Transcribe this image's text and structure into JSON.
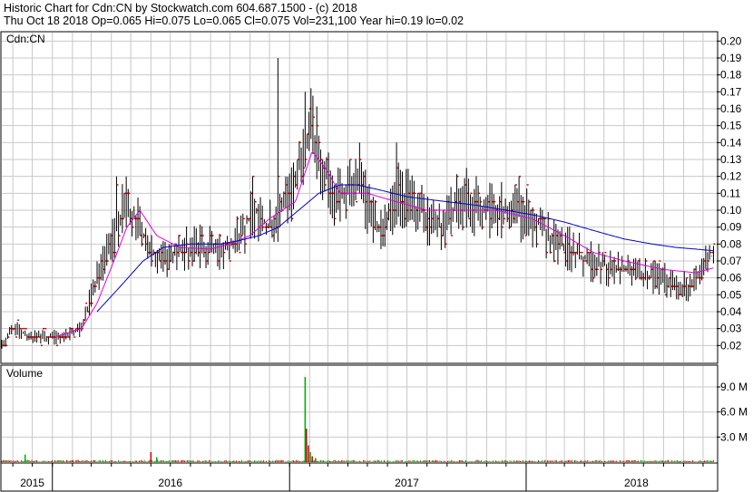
{
  "header": {
    "line1": "Historic Chart for Cdn:CN by Stockwatch.com 604.687.1500 - (c) 2018",
    "line2": "Thu Oct 18 2018   Op=0.065   Hi=0.075   Lo=0.065   Cl=0.075   Vol=231,100   Year hi=0.19   lo=0.02"
  },
  "colors": {
    "price_bars": "#000000",
    "close_marker": "#cc0000",
    "ma_short": "#e000e0",
    "ma_long": "#0000cc",
    "volume_up": "#00aa00",
    "volume_down": "#cc0000",
    "grid": "#c8c8c8"
  },
  "chart_data": [
    {
      "type": "line",
      "title": "",
      "symbol_label": "Cdn:CN",
      "y_ticks": [
        "0.20",
        "0.19",
        "0.18",
        "0.17",
        "0.16",
        "0.15",
        "0.14",
        "0.13",
        "0.12",
        "0.11",
        "0.10",
        "0.09",
        "0.08",
        "0.07",
        "0.06",
        "0.05",
        "0.04",
        "0.03",
        "0.02"
      ],
      "ylim": [
        0.01,
        0.205
      ],
      "xlim": [
        "2015-10-15",
        "2018-10-22"
      ],
      "x_labels": [
        {
          "label": "2015",
          "pos": "2015-12-01"
        },
        {
          "label": "2016",
          "pos": "2016-07-01"
        },
        {
          "label": "2017",
          "pos": "2017-07-01"
        },
        {
          "label": "2018",
          "pos": "2018-06-20"
        }
      ],
      "year_boundaries": [
        "2016-01-01",
        "2017-01-01",
        "2018-01-01"
      ],
      "vgrid_months": [
        "2015-11-01",
        "2015-12-01",
        "2016-01-01",
        "2016-02-01",
        "2016-03-01",
        "2016-04-01",
        "2016-05-01",
        "2016-06-01",
        "2016-07-01",
        "2016-08-01",
        "2016-09-01",
        "2016-10-01",
        "2016-11-01",
        "2016-12-01",
        "2017-01-01",
        "2017-02-01",
        "2017-03-01",
        "2017-04-01",
        "2017-05-01",
        "2017-06-01",
        "2017-07-01",
        "2017-08-01",
        "2017-09-01",
        "2017-10-01",
        "2017-11-01",
        "2017-12-01",
        "2018-01-01",
        "2018-02-01",
        "2018-03-01",
        "2018-04-01",
        "2018-05-01",
        "2018-06-01",
        "2018-07-01",
        "2018-08-01",
        "2018-09-01",
        "2018-10-01"
      ],
      "price_keyframes": [
        {
          "date": "2015-10-15",
          "close": 0.02
        },
        {
          "date": "2015-11-01",
          "close": 0.03
        },
        {
          "date": "2015-12-01",
          "close": 0.025
        },
        {
          "date": "2016-01-10",
          "close": 0.025
        },
        {
          "date": "2016-02-15",
          "close": 0.03
        },
        {
          "date": "2016-03-10",
          "close": 0.06
        },
        {
          "date": "2016-04-01",
          "close": 0.08
        },
        {
          "date": "2016-04-20",
          "close": 0.1
        },
        {
          "date": "2016-05-10",
          "close": 0.095
        },
        {
          "date": "2016-06-10",
          "close": 0.07
        },
        {
          "date": "2016-07-15",
          "close": 0.075
        },
        {
          "date": "2016-08-15",
          "close": 0.08
        },
        {
          "date": "2016-09-15",
          "close": 0.075
        },
        {
          "date": "2016-10-15",
          "close": 0.085
        },
        {
          "date": "2016-11-10",
          "close": 0.1
        },
        {
          "date": "2016-12-01",
          "close": 0.09
        },
        {
          "date": "2017-01-05",
          "close": 0.11
        },
        {
          "date": "2017-02-01",
          "close": 0.15
        },
        {
          "date": "2017-02-20",
          "close": 0.13
        },
        {
          "date": "2017-03-10",
          "close": 0.105
        },
        {
          "date": "2017-04-15",
          "close": 0.115
        },
        {
          "date": "2017-05-20",
          "close": 0.09
        },
        {
          "date": "2017-06-20",
          "close": 0.11
        },
        {
          "date": "2017-07-20",
          "close": 0.1
        },
        {
          "date": "2017-08-20",
          "close": 0.09
        },
        {
          "date": "2017-09-20",
          "close": 0.105
        },
        {
          "date": "2017-11-01",
          "close": 0.1
        },
        {
          "date": "2017-12-01",
          "close": 0.1
        },
        {
          "date": "2018-01-10",
          "close": 0.095
        },
        {
          "date": "2018-02-20",
          "close": 0.08
        },
        {
          "date": "2018-04-10",
          "close": 0.07
        },
        {
          "date": "2018-05-20",
          "close": 0.065
        },
        {
          "date": "2018-07-20",
          "close": 0.06
        },
        {
          "date": "2018-09-10",
          "close": 0.055
        },
        {
          "date": "2018-10-18",
          "close": 0.075
        }
      ],
      "spikes": [
        {
          "date": "2016-04-10",
          "high": 0.12
        },
        {
          "date": "2016-04-25",
          "high": 0.12
        },
        {
          "date": "2016-11-05",
          "high": 0.12
        },
        {
          "date": "2016-12-15",
          "high": 0.19
        },
        {
          "date": "2017-01-25",
          "high": 0.17
        },
        {
          "date": "2017-02-05",
          "high": 0.16
        },
        {
          "date": "2017-04-20",
          "high": 0.14
        },
        {
          "date": "2017-06-15",
          "high": 0.14
        },
        {
          "date": "2017-10-01",
          "high": 0.125
        },
        {
          "date": "2017-12-20",
          "high": 0.12
        }
      ],
      "ma_short_keyframes": [
        {
          "date": "2016-01-05",
          "value": 0.025
        },
        {
          "date": "2016-02-15",
          "value": 0.03
        },
        {
          "date": "2016-03-10",
          "value": 0.045
        },
        {
          "date": "2016-04-05",
          "value": 0.07
        },
        {
          "date": "2016-04-25",
          "value": 0.09
        },
        {
          "date": "2016-05-15",
          "value": 0.1
        },
        {
          "date": "2016-06-10",
          "value": 0.085
        },
        {
          "date": "2016-07-15",
          "value": 0.078
        },
        {
          "date": "2016-09-01",
          "value": 0.077
        },
        {
          "date": "2016-10-01",
          "value": 0.08
        },
        {
          "date": "2016-11-01",
          "value": 0.085
        },
        {
          "date": "2016-12-01",
          "value": 0.095
        },
        {
          "date": "2017-01-10",
          "value": 0.105
        },
        {
          "date": "2017-02-05",
          "value": 0.135
        },
        {
          "date": "2017-02-25",
          "value": 0.125
        },
        {
          "date": "2017-03-20",
          "value": 0.11
        },
        {
          "date": "2017-05-01",
          "value": 0.11
        },
        {
          "date": "2017-06-15",
          "value": 0.105
        },
        {
          "date": "2017-08-01",
          "value": 0.1
        },
        {
          "date": "2017-09-20",
          "value": 0.1
        },
        {
          "date": "2017-11-15",
          "value": 0.1
        },
        {
          "date": "2018-01-10",
          "value": 0.095
        },
        {
          "date": "2018-03-01",
          "value": 0.085
        },
        {
          "date": "2018-04-15",
          "value": 0.075
        },
        {
          "date": "2018-06-01",
          "value": 0.07
        },
        {
          "date": "2018-08-01",
          "value": 0.065
        },
        {
          "date": "2018-09-20",
          "value": 0.063
        },
        {
          "date": "2018-10-18",
          "value": 0.066
        }
      ],
      "ma_long_keyframes": [
        {
          "date": "2016-03-10",
          "value": 0.04
        },
        {
          "date": "2016-04-15",
          "value": 0.055
        },
        {
          "date": "2016-05-20",
          "value": 0.07
        },
        {
          "date": "2016-06-20",
          "value": 0.078
        },
        {
          "date": "2016-08-01",
          "value": 0.08
        },
        {
          "date": "2016-09-15",
          "value": 0.08
        },
        {
          "date": "2016-10-15",
          "value": 0.082
        },
        {
          "date": "2016-11-15",
          "value": 0.085
        },
        {
          "date": "2016-12-15",
          "value": 0.09
        },
        {
          "date": "2017-01-15",
          "value": 0.1
        },
        {
          "date": "2017-02-15",
          "value": 0.11
        },
        {
          "date": "2017-03-20",
          "value": 0.115
        },
        {
          "date": "2017-04-15",
          "value": 0.115
        },
        {
          "date": "2017-05-20",
          "value": 0.112
        },
        {
          "date": "2017-07-01",
          "value": 0.108
        },
        {
          "date": "2017-09-01",
          "value": 0.105
        },
        {
          "date": "2017-10-15",
          "value": 0.103
        },
        {
          "date": "2017-12-01",
          "value": 0.1
        },
        {
          "date": "2018-01-15",
          "value": 0.097
        },
        {
          "date": "2018-03-01",
          "value": 0.093
        },
        {
          "date": "2018-04-15",
          "value": 0.088
        },
        {
          "date": "2018-06-01",
          "value": 0.083
        },
        {
          "date": "2018-07-15",
          "value": 0.08
        },
        {
          "date": "2018-08-20",
          "value": 0.078
        },
        {
          "date": "2018-09-20",
          "value": 0.077
        },
        {
          "date": "2018-10-18",
          "value": 0.076
        }
      ]
    },
    {
      "type": "bar",
      "panel_label": "Volume",
      "y_ticks": [
        "9.0 M",
        "6.0 M",
        "3.0 M"
      ],
      "y_tick_values": [
        9000000,
        6000000,
        3000000
      ],
      "ylim": [
        0,
        11500000
      ],
      "baseline_volume": 150000,
      "spikes": [
        {
          "date": "2015-11-20",
          "value": 900000,
          "color": "up"
        },
        {
          "date": "2016-06-01",
          "value": 1200000,
          "color": "down"
        },
        {
          "date": "2016-06-10",
          "value": 600000,
          "color": "up"
        },
        {
          "date": "2017-01-25",
          "value": 10200000,
          "color": "up"
        },
        {
          "date": "2017-01-27",
          "value": 4000000,
          "color": "down"
        },
        {
          "date": "2017-01-30",
          "value": 2000000,
          "color": "down"
        },
        {
          "date": "2017-02-02",
          "value": 1200000,
          "color": "up"
        },
        {
          "date": "2017-02-05",
          "value": 700000,
          "color": "down"
        },
        {
          "date": "2017-02-10",
          "value": 500000,
          "color": "up"
        }
      ]
    }
  ]
}
